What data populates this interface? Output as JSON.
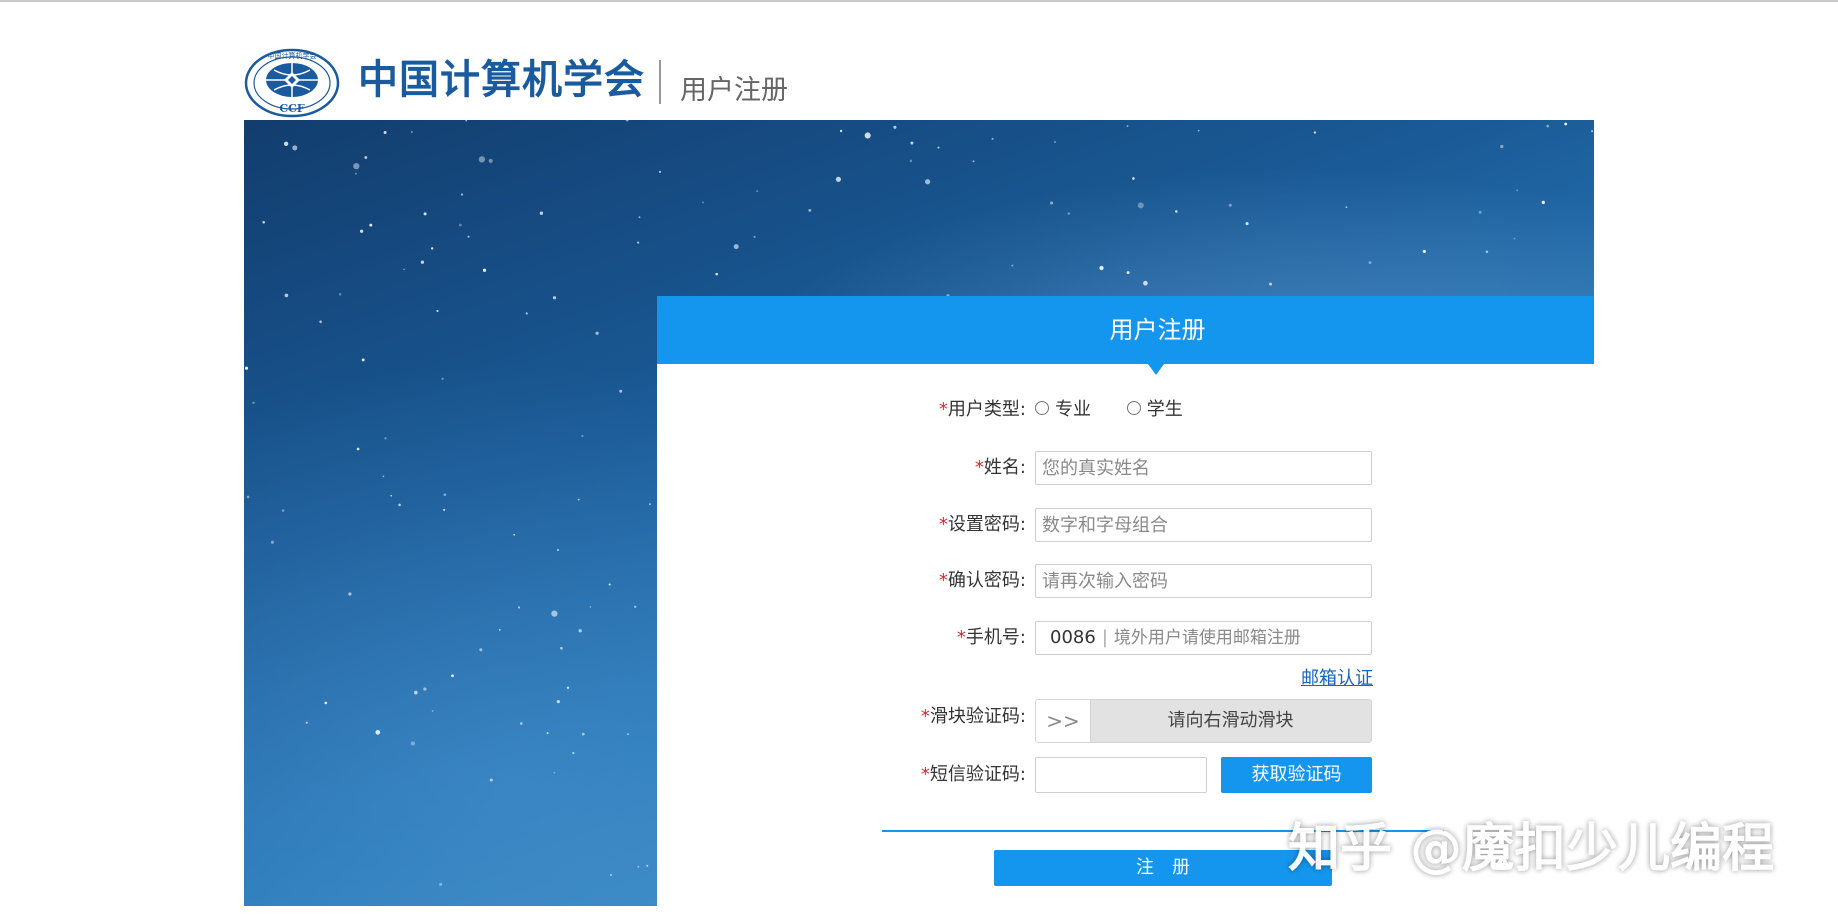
{
  "header": {
    "org_name": "中国计算机学会",
    "subtitle": "用户注册",
    "logo_text": "CCF",
    "logo_ring_text": "中国计算机学会"
  },
  "form": {
    "title": "用户注册",
    "required_mark": "*",
    "user_type": {
      "label": "用户类型:",
      "options": [
        "专业",
        "学生"
      ]
    },
    "name": {
      "label": "姓名:",
      "placeholder": "您的真实姓名",
      "value": ""
    },
    "password": {
      "label": "设置密码:",
      "placeholder": "数字和字母组合",
      "value": ""
    },
    "confirm_password": {
      "label": "确认密码:",
      "placeholder": "请再次输入密码",
      "value": ""
    },
    "phone": {
      "label": "手机号:",
      "country_code": "0086",
      "separator": "|",
      "placeholder": "境外用户请使用邮箱注册",
      "value": ""
    },
    "email_link": "邮箱认证",
    "slider_captcha": {
      "label": "滑块验证码:",
      "handle_glyph": ">>",
      "hint": "请向右滑动滑块"
    },
    "sms_code": {
      "label": "短信验证码:",
      "value": "",
      "button": "获取验证码"
    },
    "submit": "注册"
  },
  "watermark": "知乎 @魔扣少儿编程",
  "colors": {
    "primary": "#1596ee",
    "brand_text": "#1a5a9e",
    "required": "#d42a2a",
    "link": "#1565c0"
  }
}
